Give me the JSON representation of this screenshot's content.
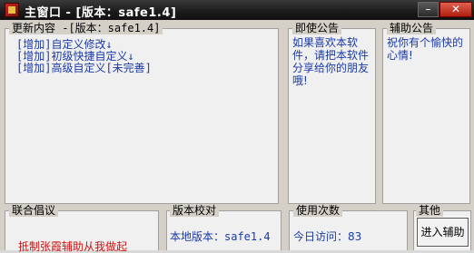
{
  "window": {
    "title": "主窗口 - [版本：safe1.4]",
    "min_label": "–",
    "close_label": "✕"
  },
  "panels": {
    "updates": {
      "label": "更新内容 -[版本：safe1.4]",
      "items": [
        "[增加]自定义修改↓",
        "[增加]初级快捷自定义↓",
        "[增加]高级自定义[未完善]"
      ]
    },
    "announce": {
      "label": "即使公告",
      "text": "如果喜欢本软件，请把本软件分享给你的朋友哦!"
    },
    "assist": {
      "label": "辅助公告",
      "text": "祝你有个愉快的心情!"
    },
    "alliance": {
      "label": "联合倡议",
      "text": "抵制张霞辅助从我做起"
    },
    "version": {
      "label": "版本校对",
      "text": "本地版本：safe1.4"
    },
    "usage": {
      "label": "使用次数",
      "text": "今日访问：83"
    },
    "other": {
      "label": "其他",
      "button": "进入辅助"
    }
  }
}
